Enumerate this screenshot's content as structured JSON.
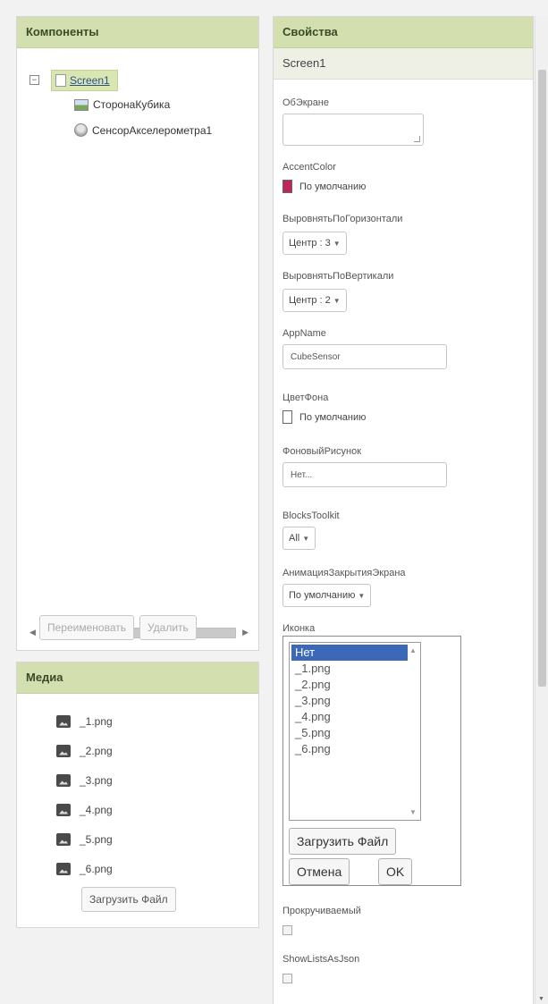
{
  "components": {
    "header": "Компоненты",
    "tree_toggle": "−",
    "root": "Screen1",
    "items": [
      {
        "label": "СторонаКубика",
        "icon": "image-sprite-icon"
      },
      {
        "label": "СенсорАкселерометра1",
        "icon": "accelerometer-icon"
      }
    ],
    "rename_label": "Переименовать",
    "delete_label": "Удалить"
  },
  "media": {
    "header": "Медиа",
    "files": [
      "_1.png",
      "_2.png",
      "_3.png",
      "_4.png",
      "_5.png",
      "_6.png"
    ],
    "upload_label": "Загрузить Файл"
  },
  "properties": {
    "header": "Свойства",
    "screen": "Screen1",
    "about_label": "ОбЭкране",
    "about_value": "",
    "accent_label": "AccentColor",
    "accent_value": "По умолчанию",
    "accent_color": "#c0255a",
    "halign_label": "ВыровнятьПоГоризонтали",
    "halign_value": "Центр : 3",
    "valign_label": "ВыровнятьПоВертикали",
    "valign_value": "Центр : 2",
    "appname_label": "AppName",
    "appname_value": "CubeSensor",
    "bgcolor_label": "ЦветФона",
    "bgcolor_value": "По умолчанию",
    "bgimage_label": "ФоновыйРисунок",
    "bgimage_value": "Нет...",
    "blocks_label": "BlocksToolkit",
    "blocks_value": "All",
    "anim_label": "АнимацияЗакрытияЭкрана",
    "anim_value": "По умолчанию",
    "icon_label": "Иконка",
    "icon_options": [
      "Нет",
      "_1.png",
      "_2.png",
      "_3.png",
      "_4.png",
      "_5.png",
      "_6.png"
    ],
    "icon_upload": "Загрузить Файл",
    "icon_cancel": "Отмена",
    "icon_ok": "OK",
    "scrollable_label": "Прокручиваемый",
    "showlists_label": "ShowListsAsJson"
  },
  "colors": {
    "header_bg": "#d3dfae",
    "selected_option": "#3b69b8"
  }
}
